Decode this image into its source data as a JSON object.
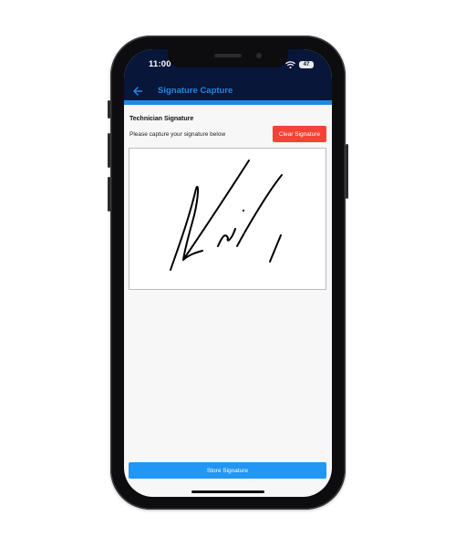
{
  "status_bar": {
    "time": "11:00",
    "battery": "47",
    "icons": [
      "location-icon",
      "signal-dots-icon",
      "wifi-icon",
      "battery-icon"
    ]
  },
  "app_bar": {
    "back_icon": "arrow-left-icon",
    "title": "Signature Capture"
  },
  "form": {
    "section_title": "Technician Signature",
    "instruction": "Please capture your signature below",
    "clear_button": "Clear Signature",
    "store_button": "Store Signature"
  },
  "colors": {
    "app_bar_bg": "#08163a",
    "accent": "#1e88e5",
    "clear_button": "#f44336",
    "store_button": "#2196f3",
    "screen_bg": "#f7f7f7",
    "ink": "#000000"
  }
}
